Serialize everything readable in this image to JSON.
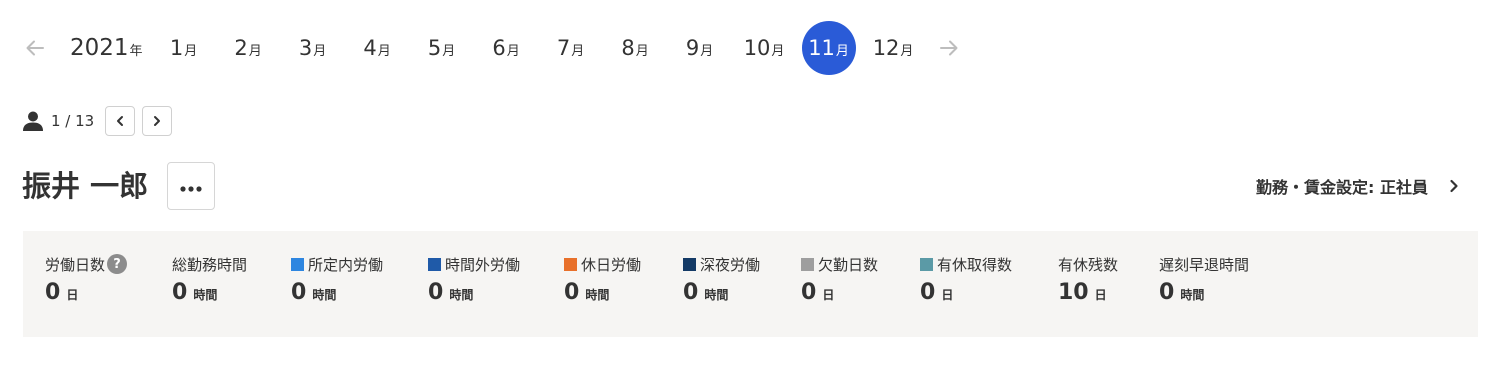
{
  "month_nav": {
    "year": "2021",
    "year_unit": "年",
    "month_unit": "月",
    "months": [
      "1",
      "2",
      "3",
      "4",
      "5",
      "6",
      "7",
      "8",
      "9",
      "10",
      "11",
      "12"
    ],
    "selected_month": "11",
    "prev_icon": "arrow-left-icon",
    "next_icon": "arrow-right-icon",
    "arrow_color": "#bdbdbd",
    "selected_color": "#2a5bd7"
  },
  "pager": {
    "count": "1 / 13",
    "person_icon": "person-icon",
    "prev_icon": "chevron-left-icon",
    "next_icon": "chevron-right-icon"
  },
  "employee": {
    "name": "振井 一郎",
    "more_icon": "more-dots-icon"
  },
  "settings_link": {
    "label": "勤務・賃金設定: 正社員",
    "icon": "chevron-right-icon"
  },
  "stats": [
    {
      "label": "労働日数",
      "value": "0",
      "unit": "日",
      "help": "?"
    },
    {
      "label": "総勤務時間",
      "value": "0",
      "unit": "時間"
    },
    {
      "label": "所定内労働",
      "value": "0",
      "unit": "時間",
      "color": "#2e86e0"
    },
    {
      "label": "時間外労働",
      "value": "0",
      "unit": "時間",
      "color": "#1f5aa8"
    },
    {
      "label": "休日労働",
      "value": "0",
      "unit": "時間",
      "color": "#e8702a"
    },
    {
      "label": "深夜労働",
      "value": "0",
      "unit": "時間",
      "color": "#143a66"
    },
    {
      "label": "欠勤日数",
      "value": "0",
      "unit": "日",
      "color": "#9e9e9e"
    },
    {
      "label": "有休取得数",
      "value": "0",
      "unit": "日",
      "color": "#5b9aa6"
    },
    {
      "label": "有休残数",
      "value": "10",
      "unit": "日"
    },
    {
      "label": "遅刻早退時間",
      "value": "0",
      "unit": "時間"
    }
  ]
}
